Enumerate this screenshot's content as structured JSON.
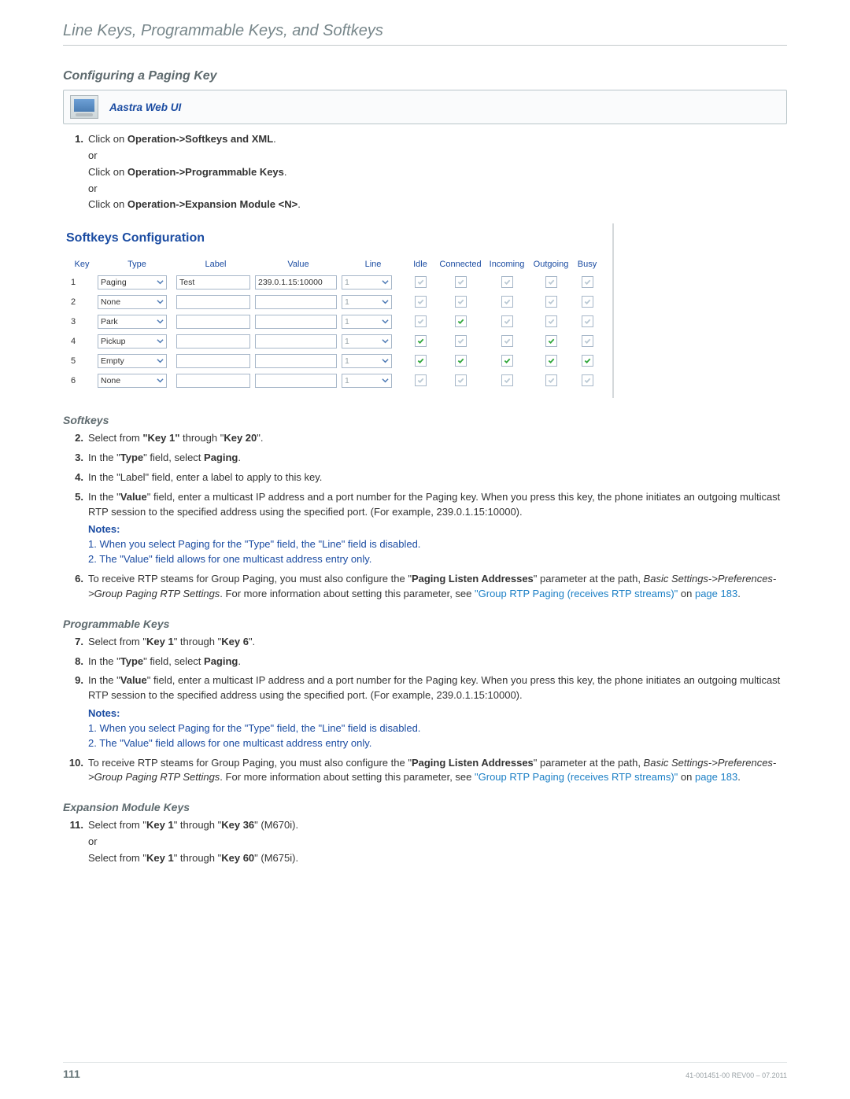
{
  "header": "Line Keys, Programmable Keys, and Softkeys",
  "section_title": "Configuring a Paging Key",
  "ui_box_label": "Aastra Web UI",
  "step1": {
    "num": "1.",
    "line1_pre": "Click on ",
    "line1_bold": "Operation->Softkeys and XML",
    "line1_post": ".",
    "or": "or",
    "line2_pre": "Click on ",
    "line2_bold": "Operation->Programmable Keys",
    "line2_post": ".",
    "line3_pre": "Click on ",
    "line3_bold": "Operation->Expansion Module <N>",
    "line3_post": "."
  },
  "screenshot": {
    "title": "Softkeys Configuration",
    "cols": {
      "key": "Key",
      "type": "Type",
      "label": "Label",
      "value": "Value",
      "line": "Line",
      "idle": "Idle",
      "connected": "Connected",
      "incoming": "Incoming",
      "outgoing": "Outgoing",
      "busy": "Busy"
    },
    "rows": [
      {
        "key": "1",
        "type": "Paging",
        "label": "Test",
        "value": "239.0.1.15:10000",
        "line": "1",
        "idle": "muted",
        "connected": "muted",
        "incoming": "muted",
        "outgoing": "muted",
        "busy": "muted"
      },
      {
        "key": "2",
        "type": "None",
        "label": "",
        "value": "",
        "line": "1",
        "idle": "muted",
        "connected": "muted",
        "incoming": "muted",
        "outgoing": "muted",
        "busy": "muted"
      },
      {
        "key": "3",
        "type": "Park",
        "label": "",
        "value": "",
        "line": "1",
        "idle": "muted",
        "connected": "on",
        "incoming": "muted",
        "outgoing": "muted",
        "busy": "muted"
      },
      {
        "key": "4",
        "type": "Pickup",
        "label": "",
        "value": "",
        "line": "1",
        "idle": "on",
        "connected": "muted",
        "incoming": "muted",
        "outgoing": "on",
        "busy": "muted"
      },
      {
        "key": "5",
        "type": "Empty",
        "label": "",
        "value": "",
        "line": "1",
        "idle": "on",
        "connected": "on",
        "incoming": "on",
        "outgoing": "on",
        "busy": "on"
      },
      {
        "key": "6",
        "type": "None",
        "label": "",
        "value": "",
        "line": "1",
        "idle": "muted",
        "connected": "muted",
        "incoming": "muted",
        "outgoing": "muted",
        "busy": "muted"
      }
    ]
  },
  "softkeys_heading": "Softkeys",
  "step2": {
    "num": "2.",
    "text_pre": "Select from ",
    "b1": "\"Key 1\"",
    "mid": " through \"",
    "b2": "Key 20",
    "post": "\"."
  },
  "step3": {
    "num": "3.",
    "text_pre": "In the \"",
    "b1": "Type",
    "mid": "\" field, select ",
    "b2": "Paging",
    "post": "."
  },
  "step4": {
    "num": "4.",
    "text": "In the \"Label\" field, enter a label to apply to this key."
  },
  "step5": {
    "num": "5.",
    "text_pre": "In the \"",
    "b1": "Value",
    "text_post": "\" field, enter a multicast IP address and a port number for the Paging key. When you press this key, the phone initiates an outgoing multicast RTP session to the specified address using the specified port. (For example, 239.0.1.15:10000).",
    "notes_label": "Notes:",
    "note1": "1. When you select Paging for the \"Type\" field, the \"Line\" field is disabled.",
    "note2": "2. The \"Value\" field allows for one multicast address entry only."
  },
  "step6": {
    "num": "6.",
    "text_pre": "To receive RTP steams for Group Paging, you must also configure the \"",
    "b1": "Paging Listen Addresses",
    "text_mid": "\" parameter at the path, ",
    "i1": "Basic Settings->Preferences->Group Paging RTP Settings",
    "text_post": ". For more information about setting this parameter, see ",
    "link": "\"Group RTP Paging (receives RTP streams)\"",
    "link_post": " on ",
    "page_link": "page 183",
    "dot": "."
  },
  "progkeys_heading": "Programmable Keys",
  "step7": {
    "num": "7.",
    "text_pre": "Select from \"",
    "b1": "Key 1",
    "mid": "\" through \"",
    "b2": "Key 6",
    "post": "\"."
  },
  "step8": {
    "num": "8.",
    "text_pre": "In the \"",
    "b1": "Type",
    "mid": "\" field, select ",
    "b2": "Paging",
    "post": "."
  },
  "step9": {
    "num": "9.",
    "text_pre": "In the \"",
    "b1": "Value",
    "text_post": "\" field, enter a multicast IP address and a port number for the Paging key. When you press this key, the phone initiates an outgoing multicast RTP session to the specified address using the specified port. (For example, 239.0.1.15:10000).",
    "notes_label": "Notes:",
    "note1": "1. When you select Paging for the \"Type\" field, the \"Line\" field is disabled.",
    "note2": "2. The \"Value\" field allows for one multicast address entry only."
  },
  "step10": {
    "num": "10.",
    "text_pre": "To receive RTP steams for Group Paging, you must also configure the \"",
    "b1": "Paging Listen Addresses",
    "text_mid": "\" parameter at the path, ",
    "i1": "Basic Settings->Preferences->Group Paging RTP Settings",
    "text_post": ". For more information about setting this parameter, see ",
    "link": "\"Group RTP Paging (receives RTP streams)\"",
    "link_post": " on ",
    "page_link": "page 183",
    "dot": "."
  },
  "expmod_heading": "Expansion Module Keys",
  "step11": {
    "num": "11.",
    "l1_pre": "Select from \"",
    "l1_b1": "Key 1",
    "l1_mid": "\" through \"",
    "l1_b2": "Key 36",
    "l1_post": "\" (M670i).",
    "or": "or",
    "l2_pre": "Select from \"",
    "l2_b1": "Key 1",
    "l2_mid": "\" through \"",
    "l2_b2": "Key 60",
    "l2_post": "\" (M675i)."
  },
  "footer": {
    "page": "111",
    "docid": "41-001451-00 REV00 – 07.2011"
  }
}
